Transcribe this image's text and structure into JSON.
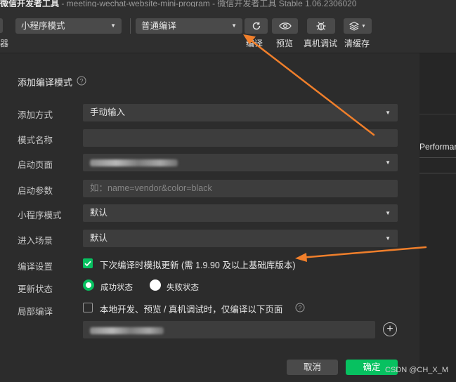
{
  "titlebar": {
    "project_name": "微信开发者工具",
    "title_rest": " - meeting-wechat-website-mini-program - 微信开发者工具 Stable 1.06.2306020"
  },
  "toolbar": {
    "left_cut_label": "器",
    "mode_select": "小程序模式",
    "compile_select": "普通编译",
    "compile_label": "编译",
    "preview_label": "预览",
    "debug_label": "真机调试",
    "cache_label": "清缓存"
  },
  "right_panel": {
    "performance_label": "Performar"
  },
  "dialog": {
    "title": "添加编译模式",
    "rows": {
      "add_method": {
        "label": "添加方式",
        "value": "手动输入"
      },
      "mode_name": {
        "label": "模式名称",
        "value": ""
      },
      "start_page": {
        "label": "启动页面"
      },
      "start_params": {
        "label": "启动参数",
        "placeholder": "如：name=vendor&color=black"
      },
      "mini_mode": {
        "label": "小程序模式",
        "value": "默认"
      },
      "scene": {
        "label": "进入场景",
        "value": "默认"
      },
      "compile_settings": {
        "label": "编译设置",
        "checkbox_text": "下次编译时模拟更新 (需 1.9.90 及以上基础库版本)",
        "checked": true
      },
      "update_status": {
        "label": "更新状态",
        "option_success": "成功状态",
        "option_fail": "失败状态",
        "selected": "成功状态"
      },
      "partial_compile": {
        "label": "局部编译",
        "checkbox_text": "本地开发、预览 / 真机调试时，仅编译以下页面",
        "checked": false
      }
    },
    "cancel_label": "取消",
    "ok_label": "确定"
  },
  "watermark": "CSDN @CH_X_M",
  "colors": {
    "accent": "#07c160",
    "arrow": "#f07f2b",
    "background": "#2c2c2c"
  }
}
